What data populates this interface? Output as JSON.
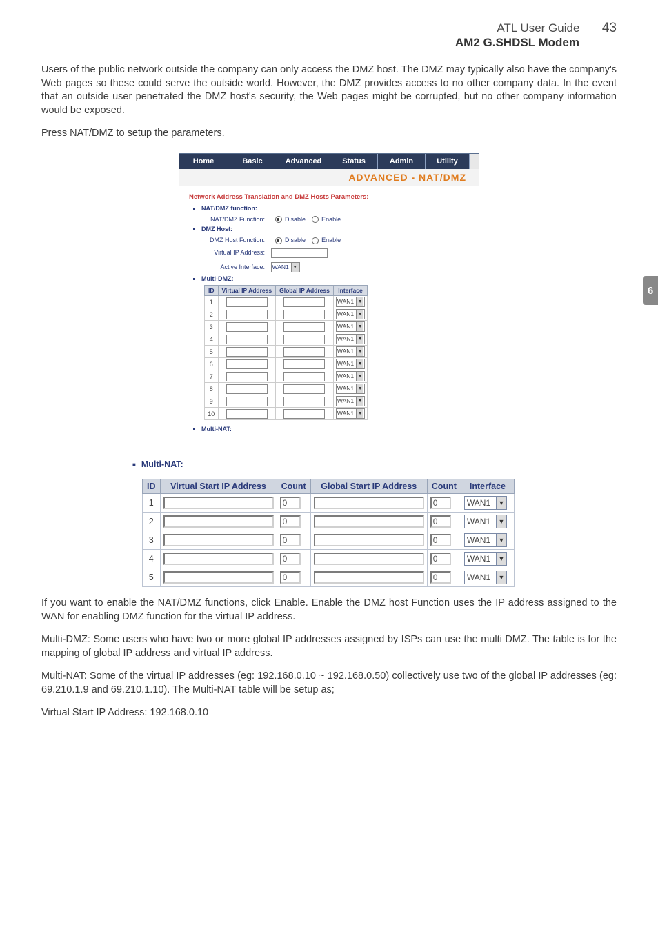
{
  "header": {
    "title": "ATL User Guide",
    "page_number": "43",
    "subtitle": "AM2 G.SHDSL Modem"
  },
  "side_tab": "6",
  "para1": "Users of the public network outside the company can only access the DMZ host. The DMZ may typically also have the company's Web pages so these could serve the outside world. However, the DMZ provides access to no other company data. In the event that an outside user penetrated the DMZ host's security, the Web pages might be corrupted, but no other company information would be exposed.",
  "para2": "Press NAT/DMZ to setup the parameters.",
  "para3": "If you want to enable the NAT/DMZ functions, click Enable. Enable the DMZ host Function uses the IP address assigned to the WAN for enabling DMZ function for the virtual IP address.",
  "para4": "Multi-DMZ: Some users who have two or more global IP addresses assigned by ISPs can use the multi DMZ. The table is for the mapping of global IP address and virtual IP address.",
  "para5": "Multi-NAT: Some of the virtual IP addresses (eg: 192.168.0.10 ~ 192.168.0.50) collectively use two of the global IP addresses (eg: 69.210.1.9 and 69.210.1.10). The Multi-NAT table will be setup as;",
  "para6": "Virtual Start IP Address: 192.168.0.10",
  "nav": {
    "home": "Home",
    "basic": "Basic",
    "advanced": "Advanced",
    "status": "Status",
    "admin": "Admin",
    "utility": "Utility"
  },
  "band_title": "ADVANCED - NAT/DMZ",
  "ss": {
    "section_title": "Network Address Translation and DMZ Hosts Parameters:",
    "natdmz_function_heading": "NAT/DMZ function:",
    "natdmz_function_label": "NAT/DMZ Function:",
    "disable": "Disable",
    "enable": "Enable",
    "dmz_host_heading": "DMZ Host:",
    "dmz_host_function_label": "DMZ Host Function:",
    "virtual_ip_label": "Virtual IP Address:",
    "active_interface_label": "Active Interface:",
    "wan_value": "WAN1",
    "multi_dmz_heading": "Multi-DMZ:",
    "col_id": "ID",
    "col_vip": "Virtual IP Address",
    "col_gip": "Global IP Address",
    "col_iface": "Interface",
    "multi_nat_heading_small": "Multi-NAT:",
    "rows": [
      "1",
      "2",
      "3",
      "4",
      "5",
      "6",
      "7",
      "8",
      "9",
      "10"
    ]
  },
  "ss2": {
    "heading": "Multi-NAT:",
    "col_id": "ID",
    "col_vs": "Virtual Start IP Address",
    "col_count": "Count",
    "col_gs": "Global Start IP Address",
    "col_iface": "Interface",
    "count_default": "0",
    "wan_value": "WAN1",
    "rows": [
      "1",
      "2",
      "3",
      "4",
      "5"
    ]
  }
}
